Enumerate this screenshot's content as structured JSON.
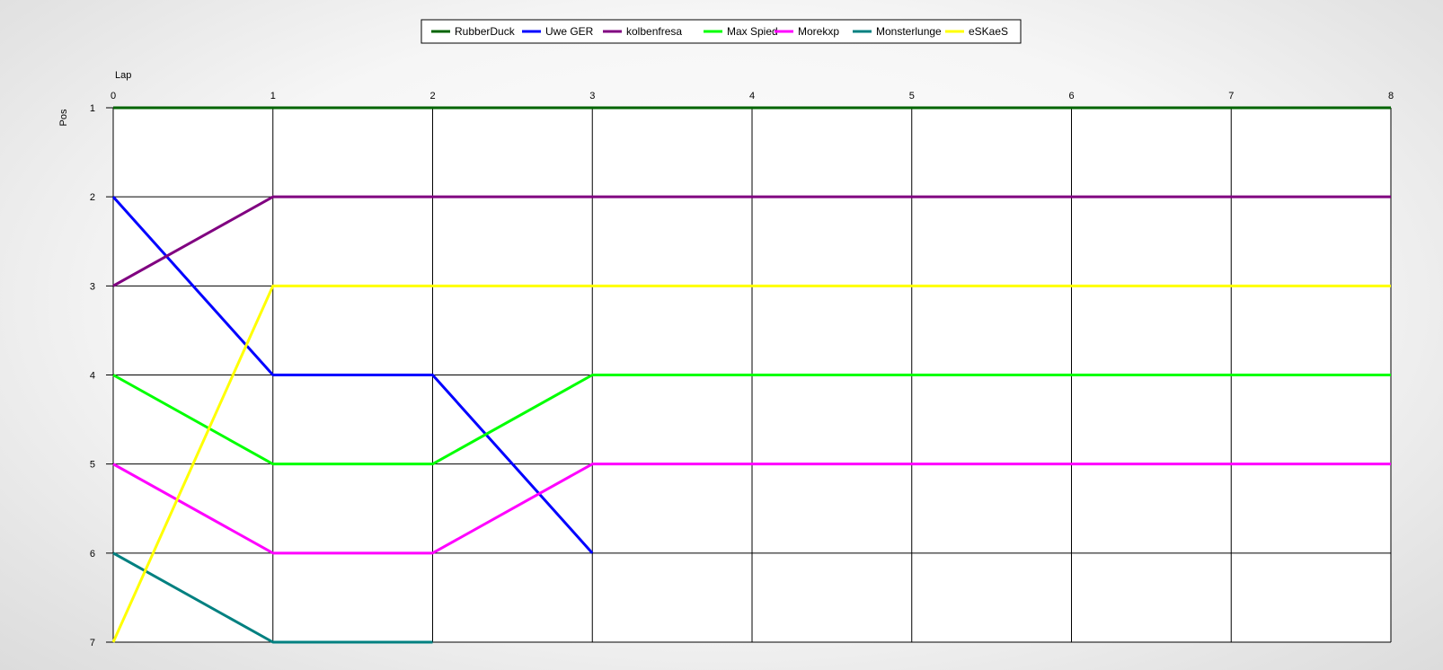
{
  "chart_data": {
    "type": "line",
    "xlabel": "Lap",
    "ylabel": "Pos",
    "x": [
      0,
      1,
      2,
      3,
      4,
      5,
      6,
      7,
      8
    ],
    "xlim": [
      0,
      8
    ],
    "ylim": [
      1,
      7
    ],
    "y_inverted": true,
    "x_ticks": [
      "0",
      "1",
      "2",
      "3",
      "4",
      "5",
      "6",
      "7",
      "8"
    ],
    "y_ticks": [
      "1",
      "2",
      "3",
      "4",
      "5",
      "6",
      "7"
    ],
    "grid": true,
    "legend_position": "top-center",
    "series": [
      {
        "name": "RubberDuck",
        "color": "#006400",
        "x": [
          0,
          1,
          2,
          3,
          4,
          5,
          6,
          7,
          8
        ],
        "values": [
          1,
          1,
          1,
          1,
          1,
          1,
          1,
          1,
          1
        ]
      },
      {
        "name": "Uwe GER",
        "color": "#0000FF",
        "x": [
          0,
          1,
          2,
          3
        ],
        "values": [
          2,
          4,
          4,
          6
        ]
      },
      {
        "name": "kolbenfresa",
        "color": "#800080",
        "x": [
          0,
          1,
          2,
          3,
          4,
          5,
          6,
          7,
          8
        ],
        "values": [
          3,
          2,
          2,
          2,
          2,
          2,
          2,
          2,
          2
        ]
      },
      {
        "name": "Max Spied",
        "color": "#00FF00",
        "x": [
          0,
          1,
          2,
          3,
          4,
          5,
          6,
          7,
          8
        ],
        "values": [
          4,
          5,
          5,
          4,
          4,
          4,
          4,
          4,
          4
        ]
      },
      {
        "name": "Morekxp",
        "color": "#FF00FF",
        "x": [
          0,
          1,
          2,
          3,
          4,
          5,
          6,
          7,
          8
        ],
        "values": [
          5,
          6,
          6,
          5,
          5,
          5,
          5,
          5,
          5
        ]
      },
      {
        "name": "Monsterlunge",
        "color": "#008080",
        "x": [
          0,
          1,
          2
        ],
        "values": [
          6,
          7,
          7
        ]
      },
      {
        "name": "eSKaeS",
        "color": "#FFFF00",
        "x": [
          0,
          1,
          2,
          3,
          4,
          5,
          6,
          7,
          8
        ],
        "values": [
          7,
          3,
          3,
          3,
          3,
          3,
          3,
          3,
          3
        ]
      }
    ]
  }
}
